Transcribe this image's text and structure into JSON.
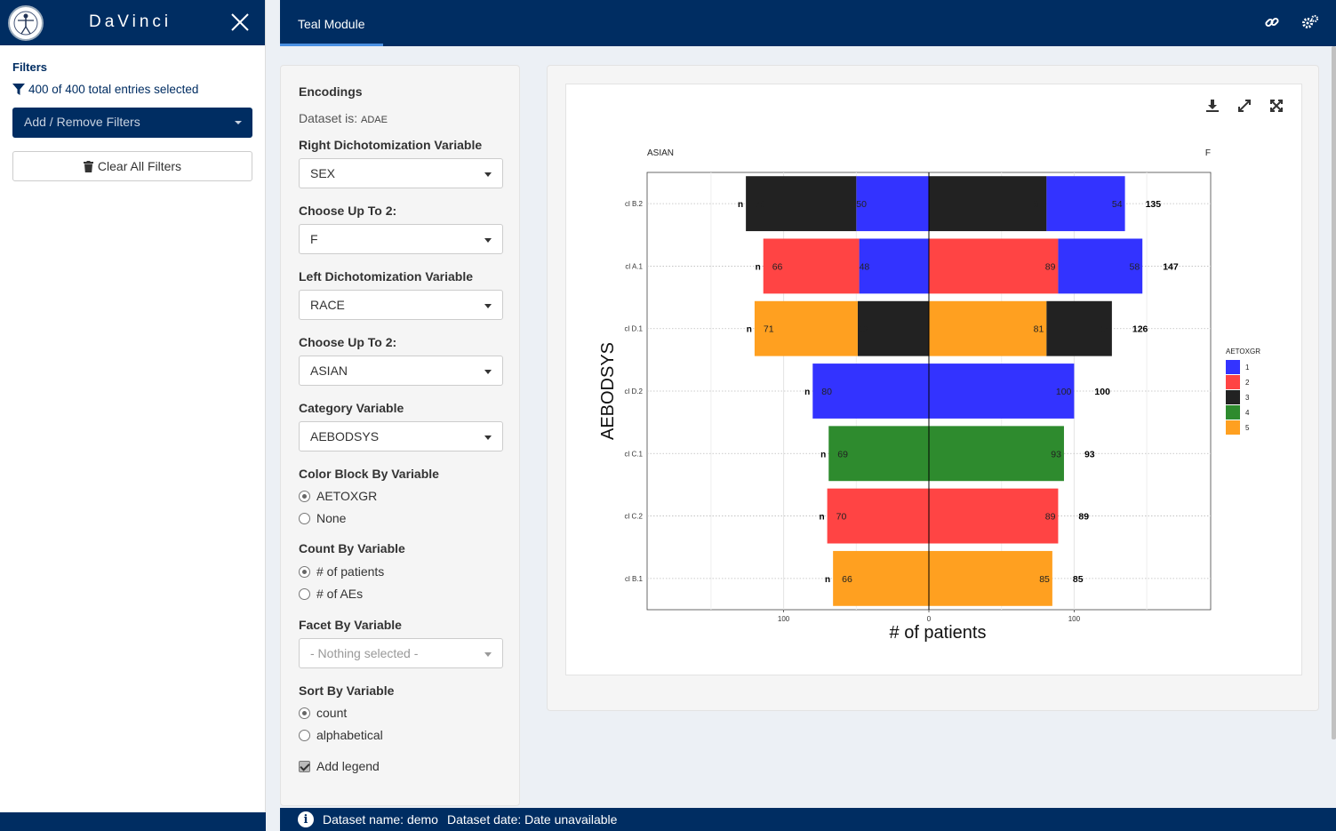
{
  "app": {
    "brand": "DaVinci"
  },
  "sidebar": {
    "filters_title": "Filters",
    "entries_text": "400 of 400 total entries selected",
    "add_remove_label": "Add / Remove Filters",
    "clear_all_label": "Clear All Filters"
  },
  "header": {
    "tab_label": "Teal Module"
  },
  "encodings": {
    "title": "Encodings",
    "dataset_prefix": "Dataset is:",
    "dataset_name": "ADAE",
    "right_dich_label": "Right Dichotomization Variable",
    "right_dich_value": "SEX",
    "choose_right_label": "Choose Up To 2:",
    "choose_right_value": "F",
    "left_dich_label": "Left Dichotomization Variable",
    "left_dich_value": "RACE",
    "choose_left_label": "Choose Up To 2:",
    "choose_left_value": "ASIAN",
    "category_label": "Category Variable",
    "category_value": "AEBODSYS",
    "color_block_label": "Color Block By Variable",
    "color_block_options": [
      "AETOXGR",
      "None"
    ],
    "color_block_selected": 0,
    "count_by_label": "Count By Variable",
    "count_by_options": [
      "# of patients",
      "# of AEs"
    ],
    "count_by_selected": 0,
    "facet_label": "Facet By Variable",
    "facet_placeholder": "- Nothing selected -",
    "sort_label": "Sort By Variable",
    "sort_options": [
      "count",
      "alphabetical"
    ],
    "sort_selected": 0,
    "legend_label": "Add legend",
    "legend_checked": true
  },
  "footer": {
    "dataset_name": "Dataset name: demo",
    "dataset_date": "Dataset date: Date unavailable"
  },
  "colors": {
    "navy": "#002d62",
    "grade1": "#3333ff",
    "grade2": "#ff4444",
    "grade3": "#222222",
    "grade4": "#2e8b2e",
    "grade5": "#ffa020"
  },
  "icons": [
    "close-icon",
    "filter-icon",
    "trash-icon",
    "link-icon",
    "gears-icon",
    "download-icon",
    "expand-icon",
    "fullscreen-icon",
    "info-icon"
  ],
  "chart_data": {
    "type": "bar",
    "orientation": "horizontal-diverging",
    "left_title": "ASIAN",
    "right_title": "F",
    "xlabel": "# of patients",
    "ylabel": "AEBODSYS",
    "xticks": [
      100,
      0,
      100
    ],
    "legend_title": "AETOXGR",
    "legend": [
      {
        "name": "1",
        "color": "#3333ff"
      },
      {
        "name": "2",
        "color": "#ff4444"
      },
      {
        "name": "3",
        "color": "#222222"
      },
      {
        "name": "4",
        "color": "#2e8b2e"
      },
      {
        "name": "5",
        "color": "#ffa020"
      }
    ],
    "categories": [
      "cl B.2",
      "cl A.1",
      "cl D.1",
      "cl D.2",
      "cl C.1",
      "cl C.2",
      "cl B.1"
    ],
    "left_n_label": "n",
    "left": [
      [
        {
          "grade": "1",
          "value": 50
        },
        {
          "grade": "3",
          "value": 76
        }
      ],
      [
        {
          "grade": "1",
          "value": 48
        },
        {
          "grade": "2",
          "value": 66
        }
      ],
      [
        {
          "grade": "3",
          "value": 49
        },
        {
          "grade": "5",
          "value": 71
        }
      ],
      [
        {
          "grade": "1",
          "value": 80
        }
      ],
      [
        {
          "grade": "4",
          "value": 69
        }
      ],
      [
        {
          "grade": "2",
          "value": 70
        }
      ],
      [
        {
          "grade": "5",
          "value": 66
        }
      ]
    ],
    "right": [
      [
        {
          "grade": "3",
          "value": 81
        },
        {
          "grade": "1",
          "value": 54
        }
      ],
      [
        {
          "grade": "2",
          "value": 89
        },
        {
          "grade": "1",
          "value": 58
        }
      ],
      [
        {
          "grade": "5",
          "value": 81
        },
        {
          "grade": "3",
          "value": 45
        }
      ],
      [
        {
          "grade": "1",
          "value": 100
        }
      ],
      [
        {
          "grade": "4",
          "value": 93
        }
      ],
      [
        {
          "grade": "2",
          "value": 89
        }
      ],
      [
        {
          "grade": "5",
          "value": 85
        }
      ]
    ],
    "right_totals": [
      135,
      147,
      126,
      100,
      93,
      89,
      85
    ],
    "xlim": [
      -194,
      194
    ]
  }
}
